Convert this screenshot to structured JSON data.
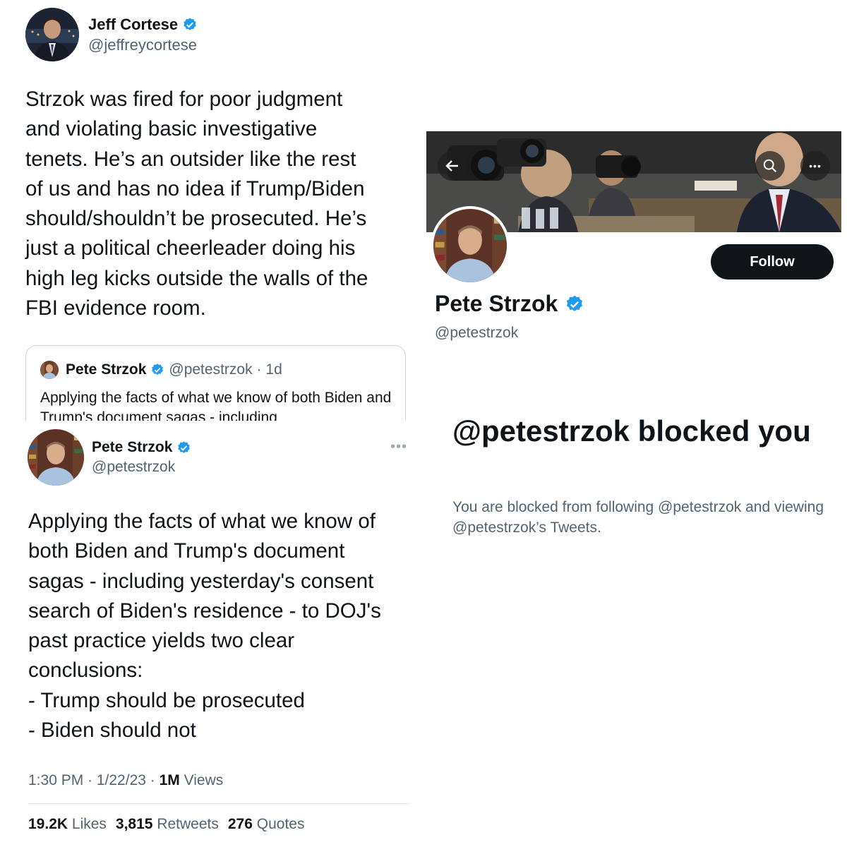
{
  "cortese_tweet": {
    "author_name": "Jeff Cortese",
    "author_handle": "@jeffreycortese",
    "text": "Strzok was fired for poor judgment\nand violating basic investigative\ntenets. He’s an outsider like the rest\nof us and has no idea if Trump/Biden\nshould/shouldn’t be prosecuted. He’s\njust a political cheerleader doing his\nhigh leg kicks outside the walls of the\nFBI evidence room.",
    "quoted": {
      "author_name": "Pete Strzok",
      "author_handle": "@petestrzok",
      "time": "· 1d",
      "text": "Applying the facts of what we know of both Biden and Trump's document sagas - including"
    }
  },
  "strzok_tweet": {
    "author_name": "Pete Strzok",
    "author_handle": "@petestrzok",
    "more_label": "•••",
    "text": "Applying the facts of what we know of\nboth Biden and Trump's document\nsagas - including yesterday's consent\nsearch of Biden's residence - to DOJ's\npast practice yields two clear\nconclusions:\n- Trump should be prosecuted\n- Biden should not",
    "time": "1:30 PM · 1/22/23 · ",
    "views_count": "1M",
    "views_label": " Views",
    "likes_count": "19.2K",
    "likes_label": "Likes",
    "retweets_count": "3,815",
    "retweets_label": "Retweets",
    "quotes_count": "276",
    "quotes_label": "Quotes"
  },
  "profile": {
    "name": "Pete Strzok",
    "handle": "@petestrzok",
    "follow_label": "Follow",
    "more_label": "•••",
    "blocked_title": "@petestrzok blocked you",
    "blocked_message": "You are blocked from following @petestrzok and viewing @petestrzok’s Tweets."
  },
  "colors": {
    "verified": "#1d9bf0",
    "secondary_text": "#536471",
    "primary_text": "#0f1419",
    "border": "#cfd9de"
  },
  "icons": {
    "verified": "verified-badge-icon",
    "back": "arrow-left-icon",
    "search": "search-icon",
    "more": "more-icon"
  }
}
